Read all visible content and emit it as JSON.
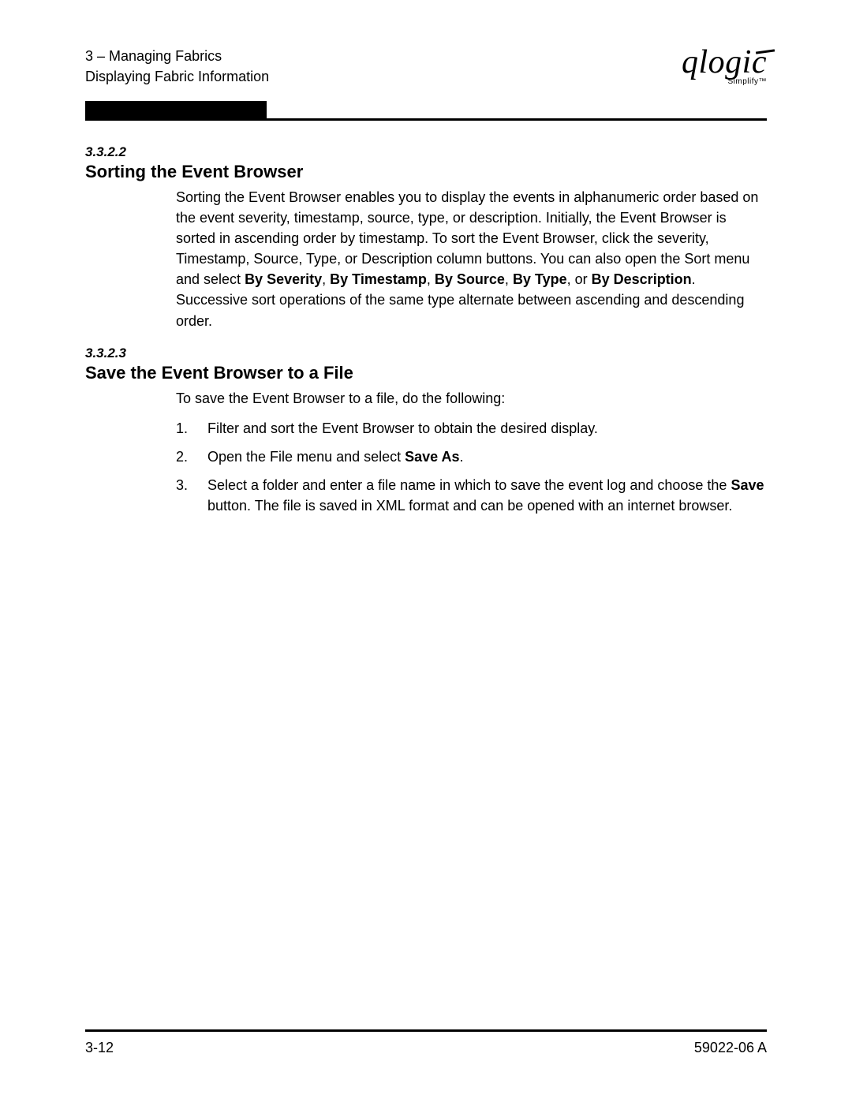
{
  "header": {
    "chapter_line": "3 – Managing Fabrics",
    "subline": "Displaying Fabric Information",
    "logo_text": "qlogic",
    "logo_tag": "Simplify™"
  },
  "section1": {
    "number": "3.3.2.2",
    "title": "Sorting the Event Browser",
    "para_pre": "Sorting the Event Browser enables you to display the events in alphanumeric order based on the event severity, timestamp, source, type, or description. Initially, the Event Browser is sorted in ascending order by timestamp. To sort the Event Browser, click the severity, Timestamp, Source, Type, or Description column buttons. You can also open the Sort menu and select ",
    "bold1": "By Severity",
    "sep1": ", ",
    "bold2": "By Timestamp",
    "sep2": ", ",
    "bold3": "By Source",
    "sep3": ", ",
    "bold4": "By Type",
    "sep4": ", or ",
    "bold5": "By Description",
    "para_post": ". Successive sort operations of the same type alternate between ascending and descending order."
  },
  "section2": {
    "number": "3.3.2.3",
    "title": "Save the Event Browser to a File",
    "intro": "To save the Event Browser to a file, do the following:",
    "steps": {
      "n1": "1.",
      "t1": "Filter and sort the Event Browser to obtain the desired display.",
      "n2": "2.",
      "t2_pre": "Open the File menu and select ",
      "t2_bold": "Save As",
      "t2_post": ".",
      "n3": "3.",
      "t3_pre": "Select a folder and enter a file name in which to save the event log and choose the ",
      "t3_bold": "Save",
      "t3_post": " button. The file is saved in XML format and can be opened with an internet browser."
    }
  },
  "footer": {
    "page": "3-12",
    "docid": "59022-06  A"
  }
}
